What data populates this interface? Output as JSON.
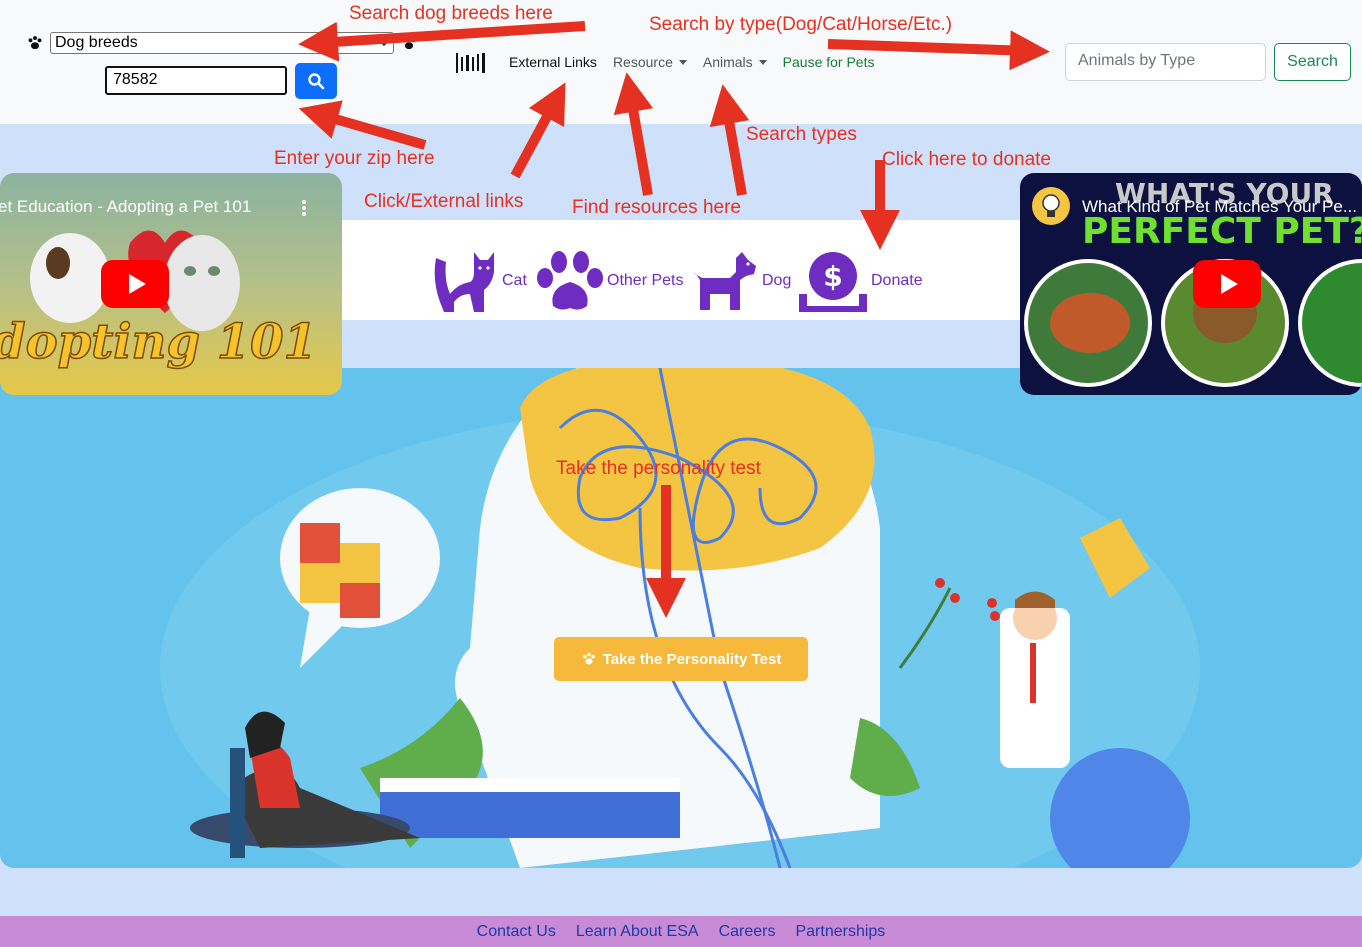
{
  "navbar": {
    "breed_select_value": "Dog breeds",
    "zip_value": "78582",
    "links": [
      {
        "label": "External Links"
      },
      {
        "label": "Resource"
      },
      {
        "label": "Animals"
      },
      {
        "label": "Pause for Pets"
      }
    ],
    "type_search_placeholder": "Animals by Type",
    "type_search_button": "Search"
  },
  "icon_strip": {
    "items": [
      {
        "label": "Cat",
        "icon": "cat-icon"
      },
      {
        "label": "Other Pets",
        "icon": "paw-icon"
      },
      {
        "label": "Dog",
        "icon": "dog-icon"
      },
      {
        "label": "Donate",
        "icon": "donate-icon"
      }
    ]
  },
  "videos": {
    "left_title": "et Education - Adopting a Pet 101",
    "left_overlay_text": "dopting 101",
    "right_title": "What Kind of Pet Matches Your Pe...",
    "right_overlay_line1": "WHAT'S YOUR",
    "right_overlay_line2": "PERFECT PET?"
  },
  "hero": {
    "cta_label": "Take the Personality Test"
  },
  "footer": {
    "links": [
      "Contact Us",
      "Learn About ESA",
      "Careers",
      "Partnerships"
    ]
  },
  "annotations": {
    "search_breeds": "Search dog breeds here",
    "search_type": "Search by type(Dog/Cat/Horse/Etc.)",
    "zip": "Enter your zip here",
    "external": "Click/External links",
    "resources": "Find resources here",
    "types": "Search types",
    "donate": "Click here to donate",
    "test": "Take the personality test"
  },
  "colors": {
    "accent_purple": "#6f2cc1",
    "cta_yellow": "#f6b93b",
    "annotation_red": "#e53122",
    "primary_blue": "#0d6efd",
    "success_green": "#198754"
  }
}
